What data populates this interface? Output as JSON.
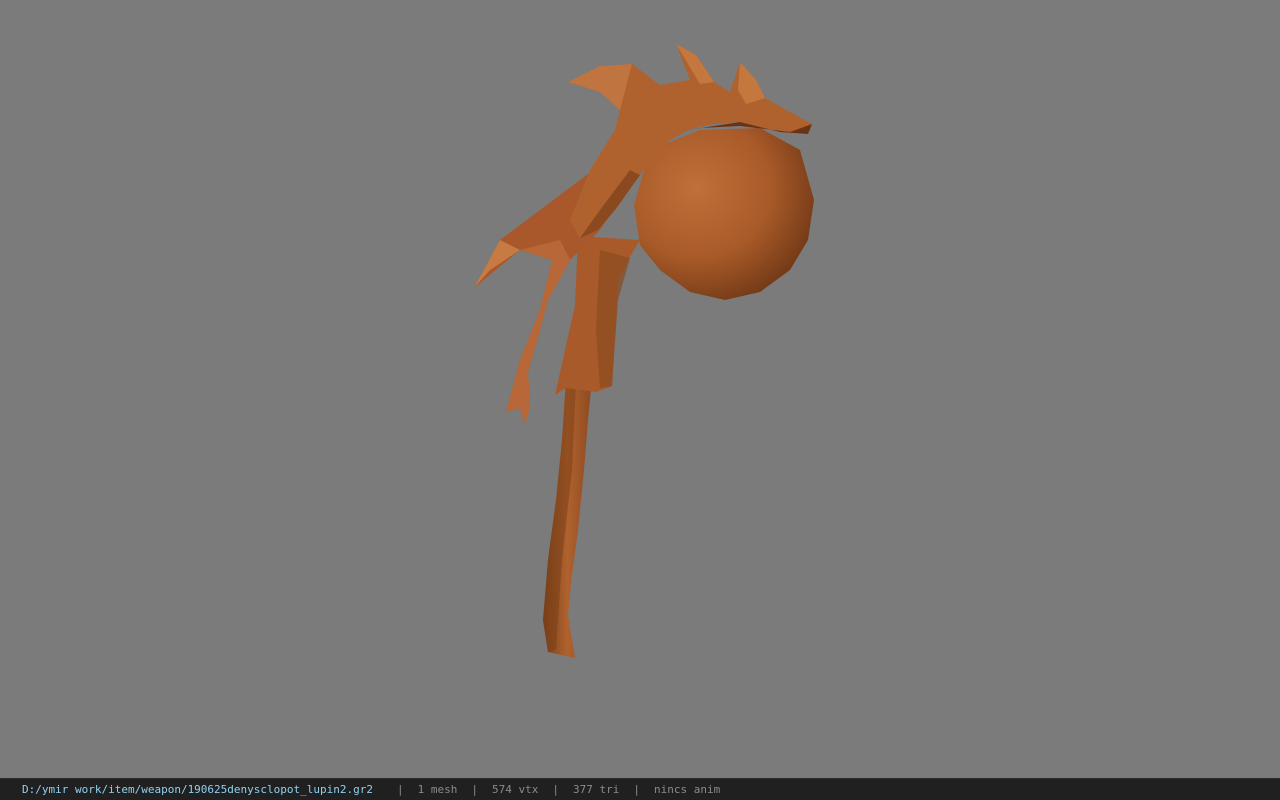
{
  "viewer": {
    "background_color": "#7b7b7b",
    "model_color": "#b0622e",
    "model": "wooden-mace"
  },
  "status_bar": {
    "file_path": "D:/ymir work/item/weapon/190625denysclopot_lupin2.gr2",
    "separator": "|",
    "mesh_count": "1 mesh",
    "vertex_count": "574 vtx",
    "triangle_count": "377 tri",
    "animation": "nincs anim"
  }
}
